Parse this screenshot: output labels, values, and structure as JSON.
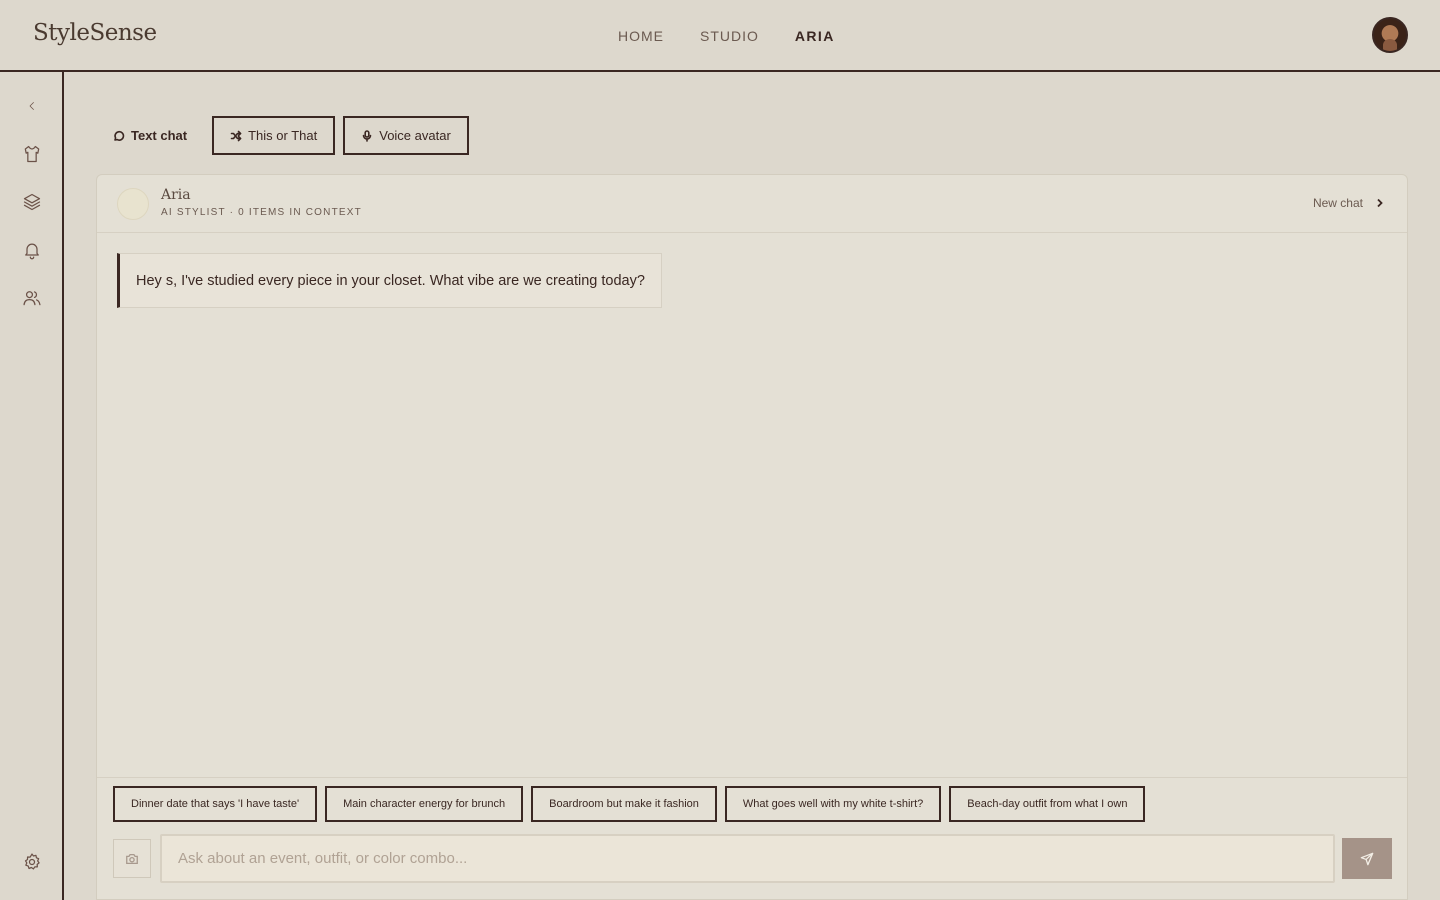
{
  "header": {
    "logo": "StyleSense",
    "nav": [
      {
        "label": "HOME",
        "active": false
      },
      {
        "label": "STUDIO",
        "active": false
      },
      {
        "label": "ARIA",
        "active": true
      }
    ]
  },
  "sidebar": {
    "icons": [
      "chevron-left-icon",
      "shirt-icon",
      "layers-icon",
      "bell-icon",
      "users-icon",
      "gear-icon"
    ]
  },
  "modes": [
    {
      "label": "Text chat",
      "icon": "message-circle-icon",
      "active": true
    },
    {
      "label": "This or That",
      "icon": "shuffle-icon",
      "active": false
    },
    {
      "label": "Voice avatar",
      "icon": "mic-icon",
      "active": false
    }
  ],
  "chat": {
    "assistant_name": "Aria",
    "assistant_subtitle": "AI STYLIST · 0 ITEMS IN CONTEXT",
    "new_chat_label": "New chat",
    "messages": [
      {
        "from": "assistant",
        "text": "Hey s, I've studied every piece in your closet. What vibe are we creating today?"
      }
    ],
    "suggestions": [
      "Dinner date that says 'I have taste'",
      "Main character energy for brunch",
      "Boardroom but make it fashion",
      "What goes well with my white t-shirt?",
      "Beach-day outfit from what I own"
    ],
    "input_placeholder": "Ask about an event, outfit, or color combo...",
    "input_value": ""
  },
  "colors": {
    "background": "#ddd8cd",
    "panel": "#e4e0d5",
    "accent_dark": "#3a2722",
    "send_button": "#a59388"
  }
}
